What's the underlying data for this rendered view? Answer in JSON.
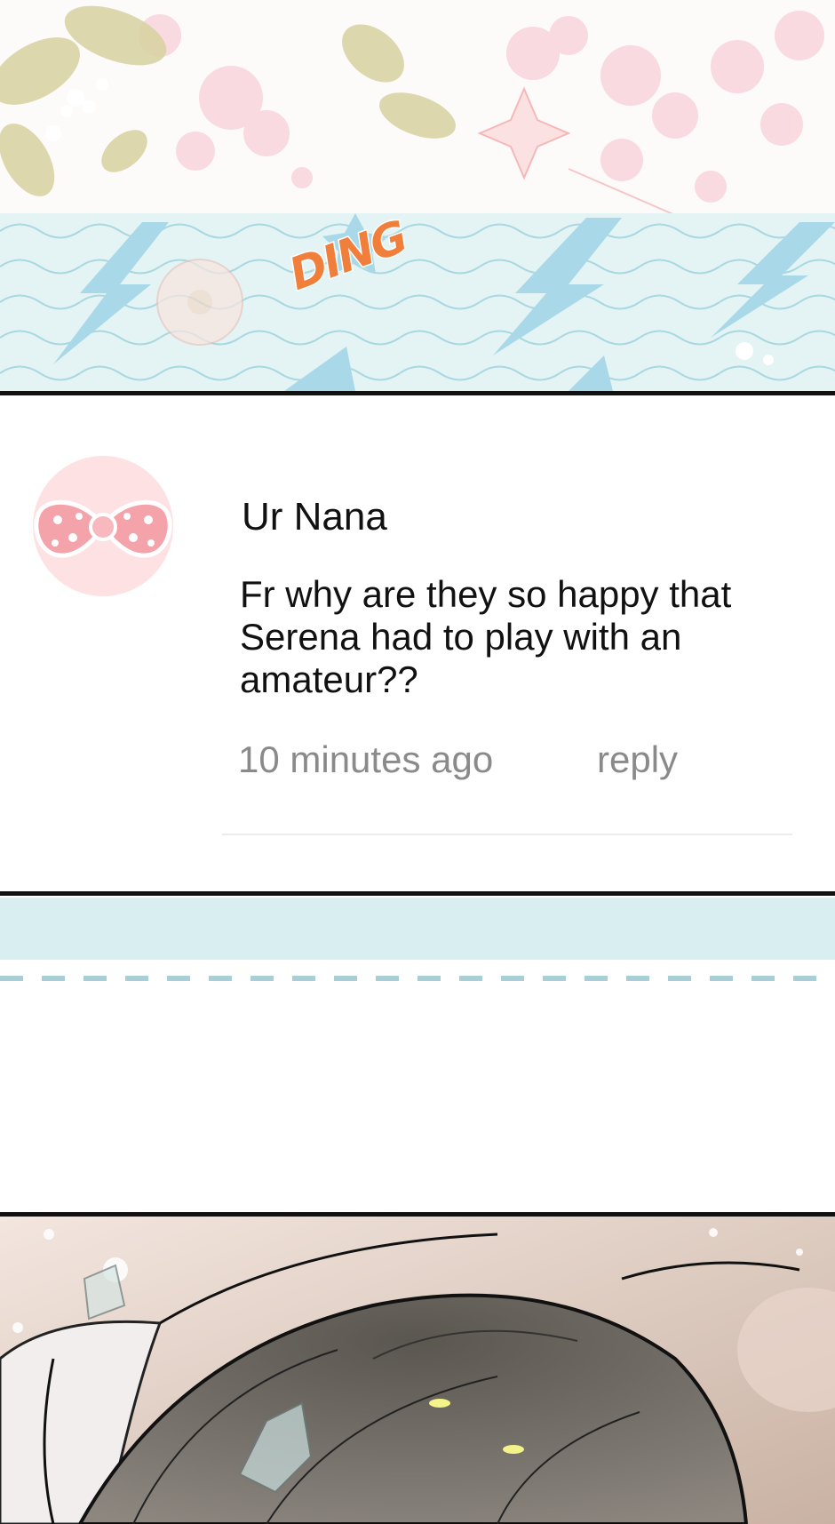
{
  "sound_effect": "DING",
  "comment": {
    "author": "Ur Nana",
    "text": "Fr why are they so happy that Serena had to play with an amateur??",
    "timestamp": "10 minutes ago",
    "reply_label": "reply"
  },
  "colors": {
    "sfx": "#f07f3c",
    "band": "#d9eef0",
    "avatar_bg": "#fde1e3",
    "meta_text": "#8a8a8a"
  },
  "icons": {
    "avatar": "pink-polka-dot-bow-icon"
  }
}
